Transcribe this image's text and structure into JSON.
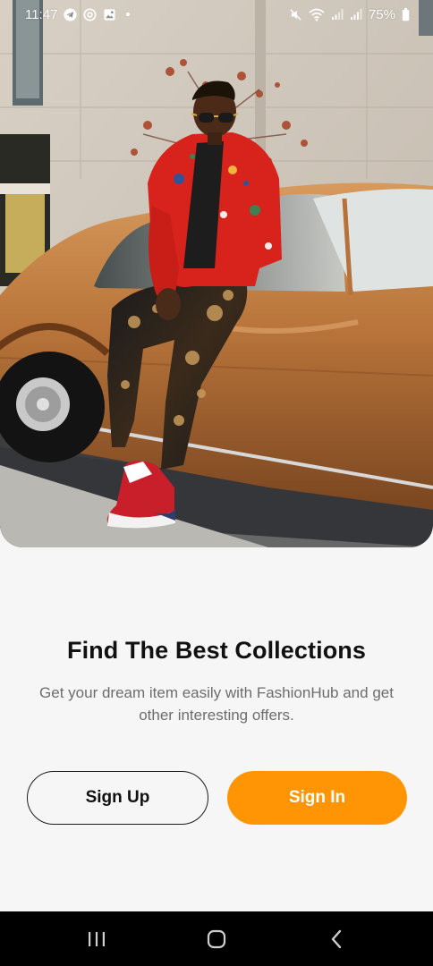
{
  "status_bar": {
    "time": "11:47",
    "battery": "75%",
    "left_icons": [
      "telegram-icon",
      "at-sign-icon",
      "gallery-icon",
      "notification-dot"
    ],
    "right_icons": [
      "mute-icon",
      "wifi-icon",
      "signal-icon",
      "signal-icon",
      "battery-icon"
    ]
  },
  "hero": {
    "icon": "fashion-photo"
  },
  "content": {
    "title": "Find The Best Collections",
    "subtitle": "Get your dream item easily with FashionHub and get other interesting offers."
  },
  "buttons": {
    "sign_up": "Sign Up",
    "sign_in": "Sign In"
  },
  "nav_bar": {
    "icons": [
      "recent-apps-icon",
      "home-icon",
      "back-icon"
    ]
  },
  "colors": {
    "accent": "#ff9505",
    "background": "#f6f6f6",
    "title": "#111111",
    "subtitle": "#6d6d6d"
  }
}
